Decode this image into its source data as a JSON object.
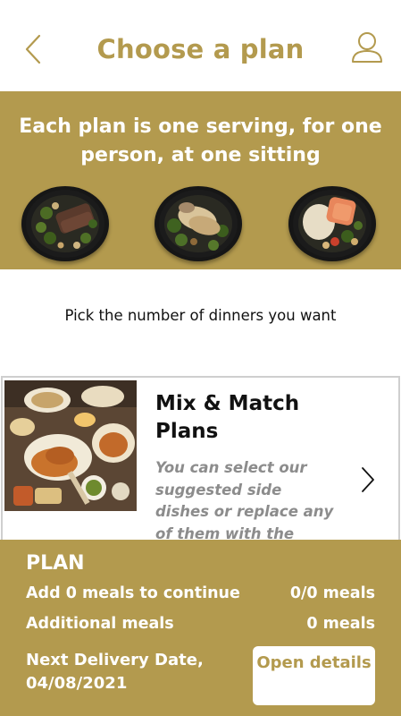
{
  "header": {
    "title": "Choose a plan",
    "back_icon": "chevron-left-icon",
    "profile_icon": "user-icon"
  },
  "hero": {
    "text": "Each plan is one serving, for one person, at one sitting"
  },
  "pick_prompt": "Pick the number of dinners you want",
  "card": {
    "title": "Mix & Match Plans",
    "description": "You can select our suggested side dishes or replace any of them with the",
    "chevron_icon": "chevron-right-icon"
  },
  "footer": {
    "plan_label": "PLAN",
    "add_meals_text": "Add 0 meals to continue",
    "meal_count": "0/0 meals",
    "additional_label": "Additional meals",
    "additional_count": "0 meals",
    "delivery_text": "Next Delivery Date, 04/08/2021",
    "details_button": "Open details"
  },
  "colors": {
    "brand": "#b39a4e",
    "muted_text": "#8c8c8c"
  }
}
